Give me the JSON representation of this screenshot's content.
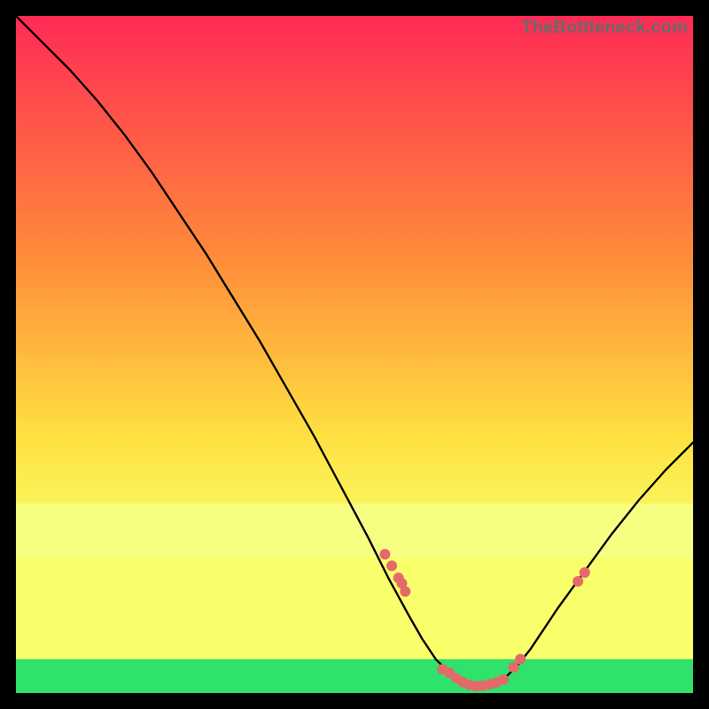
{
  "watermark": "TheBottleneck.com",
  "colors": {
    "gradient_top": "#ff2a55",
    "gradient_mid1": "#ff8a3a",
    "gradient_mid2": "#ffe040",
    "gradient_low": "#f8ff6a",
    "gradient_green": "#2fe26b",
    "curve": "#000000",
    "dot": "#e46a6a",
    "frame_bg": "#000000"
  },
  "chart_data": {
    "type": "line",
    "title": "",
    "xlabel": "",
    "ylabel": "",
    "xlim": [
      0,
      100
    ],
    "ylim": [
      0,
      100
    ],
    "grid": false,
    "legend": false,
    "series": [
      {
        "name": "bottleneck-curve",
        "x": [
          0,
          4,
          8,
          12,
          16,
          20,
          24,
          28,
          32,
          36,
          40,
          44,
          48,
          52,
          55,
          58,
          60,
          62,
          64,
          66,
          68,
          70,
          72,
          74,
          76,
          78,
          80,
          84,
          88,
          92,
          96,
          100
        ],
        "y": [
          100,
          96,
          92,
          87.5,
          82.5,
          77,
          71,
          65,
          58.5,
          52,
          45,
          38,
          30.5,
          23,
          17,
          11.5,
          8,
          5,
          3,
          1.5,
          1,
          1.3,
          2,
          4,
          6.5,
          9.5,
          12.5,
          18,
          23.5,
          28.5,
          33,
          37
        ]
      }
    ],
    "dots": {
      "name": "highlight-points",
      "x": [
        54.5,
        55.5,
        56.5,
        57.0,
        57.5,
        63.0,
        64.0,
        65.0,
        66.0,
        67.0,
        68.0,
        69.0,
        70.0,
        71.0,
        72.0,
        73.5,
        74.5,
        83.0,
        84.0
      ],
      "y": [
        20.5,
        18.8,
        17.0,
        16.2,
        15.0,
        3.5,
        3.0,
        2.2,
        1.6,
        1.2,
        1.0,
        1.1,
        1.3,
        1.6,
        2.0,
        3.8,
        5.0,
        16.5,
        17.8
      ]
    },
    "bands": [
      {
        "name": "pale-yellow",
        "from_y": 20,
        "to_y": 28,
        "color": "#f6ff81"
      },
      {
        "name": "green",
        "from_y": 0,
        "to_y": 5,
        "color": "#2fe26b"
      }
    ]
  }
}
